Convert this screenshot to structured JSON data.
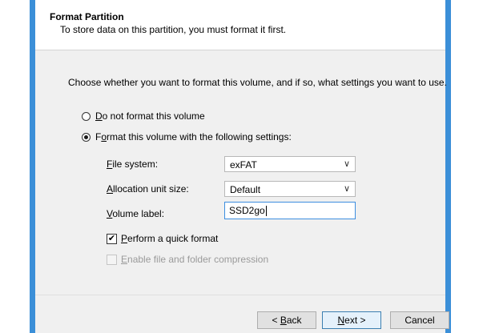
{
  "header": {
    "title": "Format Partition",
    "subtitle": "To store data on this partition, you must format it first."
  },
  "content": {
    "instruction": "Choose whether you want to format this volume, and if so, what settings you want to use.",
    "radio_no_format": {
      "key": "D",
      "rest": "o not format this volume",
      "checked": false
    },
    "radio_format": {
      "before": "F",
      "key": "o",
      "rest": "rmat this volume with the following settings:",
      "checked": true
    },
    "file_system": {
      "key": "F",
      "rest": "ile system:",
      "value": "exFAT"
    },
    "allocation_unit": {
      "key": "A",
      "rest": "llocation unit size:",
      "value": "Default"
    },
    "volume_label": {
      "key": "V",
      "rest": "olume label:",
      "value": "SSD2go"
    },
    "quick_format": {
      "key": "P",
      "rest": "erform a quick format",
      "checked": true
    },
    "compression": {
      "key": "E",
      "rest": "nable file and folder compression",
      "checked": false,
      "enabled": false
    }
  },
  "footer": {
    "back": {
      "before": "< ",
      "key": "B",
      "rest": "ack"
    },
    "next": {
      "key": "N",
      "rest": "ext >"
    },
    "cancel": "Cancel"
  },
  "colors": {
    "frame": "#3b8fd8",
    "panel": "#f0f0f0"
  }
}
